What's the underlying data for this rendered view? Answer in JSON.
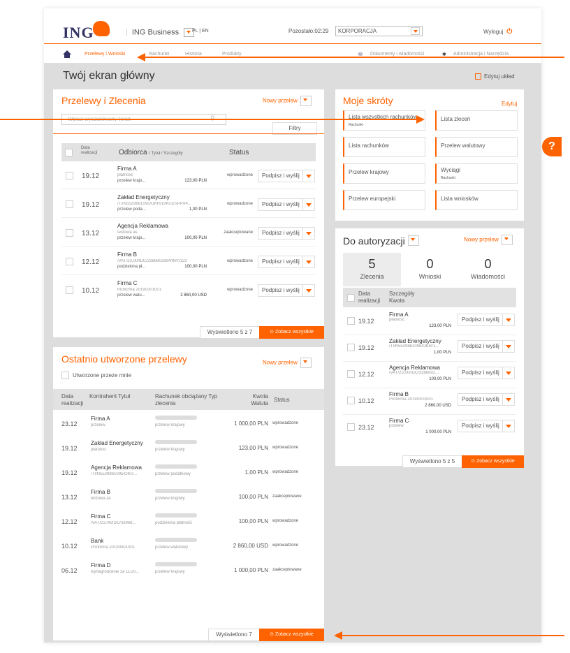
{
  "header": {
    "logo": "ING",
    "app_name": "ING Business",
    "lang": "PL | EN",
    "timer": "Pozostało:02:29",
    "company": "KORPORACJA",
    "logout": "Wyloguj"
  },
  "nav": {
    "items": [
      "Przelewy i Wnioski",
      "Rachunki",
      "Historia",
      "Produkty"
    ],
    "right": [
      "Dokumenty i wiadomości",
      "Administracja i Narzędzia"
    ]
  },
  "page": {
    "title": "Twój ekran główny",
    "edit_layout": "Edytuj układ",
    "help": "?"
  },
  "transfers": {
    "title": "Przelewy i Zlecenia",
    "new_label": "Nowy przelew",
    "search_placeholder": "Wpisz wyszukiwany tekst",
    "filters": "Filtry",
    "col_date": "Data realizacji",
    "col_recipient": "Odbiorca",
    "col_recipient_sub": "/ Tytuł / Szczegóły",
    "col_status": "Status",
    "sign_label": "Podpisz i wyślij",
    "rows": [
      {
        "date": "19.12",
        "name": "Firma A",
        "l1": "płatność",
        "l2": "przelew krajo...",
        "amount": "123,00 PLN",
        "status": "wprowadzone"
      },
      {
        "date": "19.12",
        "name": "Zakład Energetyczny",
        "l1": "/TI/N5529861095/OKR/19K01/SPP/Pł...",
        "l2": "przelew poda...",
        "amount": "1,00 PLN",
        "status": "wprowadzone"
      },
      {
        "date": "13.12",
        "name": "Agencja Reklamowa",
        "l1": "testowa as",
        "l2": "przelew krajo...",
        "amount": "100,00 PLN",
        "status": "zaakceptowane"
      },
      {
        "date": "12.12",
        "name": "Firma B",
        "l1": "/VAT/23,00/IDC/3386802894/INV/123",
        "l2": "podzielona pł...",
        "amount": "100,00 PLN",
        "status": "wprowadzone"
      },
      {
        "date": "10.12",
        "name": "Firma C",
        "l1": "Proforma 20190301001",
        "l2": "przelew walu...",
        "amount": "2 860,00 USD",
        "status": "wprowadzone"
      }
    ],
    "footer_count": "Wyświetlono 5 z 7",
    "footer_see_all": "Zobacz wszystkie"
  },
  "recent": {
    "title": "Ostatnio utworzone przelewy",
    "new_label": "Nowy przelew",
    "filter_mine": "Utworzone przeze mnie",
    "col_date": "Data realizacji",
    "col_contractor": "Kontrahent Tytuł",
    "col_account": "Rachunek obciążany Typ zlecenia",
    "col_amount": "Kwota Waluta",
    "col_status": "Status",
    "rows": [
      {
        "date": "23.12",
        "name": "Firma A",
        "title": "przelew",
        "type": "przelew krajowy",
        "amount": "1 000,00 PLN",
        "status": "wprowadzone"
      },
      {
        "date": "19.12",
        "name": "Zakład Energetyczny",
        "title": "płatność",
        "type": "przelew krajowy",
        "amount": "123,00 PLN",
        "status": "wprowadzone"
      },
      {
        "date": "19.12",
        "name": "Agencja Reklamowa",
        "title": "/TI/N5529861095/OKR...",
        "type": "przelew podatkowy",
        "amount": "1,00 PLN",
        "status": "wprowadzone"
      },
      {
        "date": "13.12",
        "name": "Firma B",
        "title": "testowa as",
        "type": "przelew krajowy",
        "amount": "100,00 PLN",
        "status": "zaakceptowane"
      },
      {
        "date": "12.12",
        "name": "Firma C",
        "title": "/VAT/23,00/IDC/33868...",
        "type": "podzielona płatność",
        "amount": "100,00 PLN",
        "status": "wprowadzone"
      },
      {
        "date": "10.12",
        "name": "Bank",
        "title": "Proforma 20190301001",
        "type": "przelew walutowy",
        "amount": "2 860,00 USD",
        "status": "wprowadzone"
      },
      {
        "date": "06.12",
        "name": "Firma D",
        "title": "wynagrodzenie za 11/20...",
        "type": "przelew krajowy",
        "amount": "1 000,00 PLN",
        "status": "zaakceptowane"
      }
    ],
    "footer_count": "Wyświetlono 7",
    "footer_see_all": "Zobacz wszystkie"
  },
  "shortcuts": {
    "title": "Moje skróty",
    "edit": "Edytuj",
    "tiles": [
      {
        "label": "Lista wszystkich rachunków",
        "sub": "Rachunki"
      },
      {
        "label": "Lista zleceń",
        "sub": ""
      },
      {
        "label": "Lista rachunków",
        "sub": ""
      },
      {
        "label": "Przelew walutowy",
        "sub": ""
      },
      {
        "label": "Przelew krajowy",
        "sub": ""
      },
      {
        "label": "Wyciągi",
        "sub": "Rachunki"
      },
      {
        "label": "Przelew europejski",
        "sub": ""
      },
      {
        "label": "Lista wniosków",
        "sub": ""
      }
    ]
  },
  "auth": {
    "title": "Do autoryzacji",
    "new_label": "Nowy przelew",
    "tabs": [
      {
        "count": "5",
        "label": "Zlecenia"
      },
      {
        "count": "0",
        "label": "Wnioski"
      },
      {
        "count": "0",
        "label": "Wiadomości"
      }
    ],
    "col_date": "Data realizacji",
    "col_details": "Szczegóły Kwota",
    "sign_label": "Podpisz i wyślij",
    "rows": [
      {
        "date": "19.12",
        "name": "Firma A",
        "l1": "płatność",
        "amount": "123,00 PLN"
      },
      {
        "date": "19.12",
        "name": "Zakład Energetyczny",
        "l1": "/TI/N5529861095/OKR/1...",
        "amount": "1,00 PLN"
      },
      {
        "date": "12.12",
        "name": "Agencja Reklamowa",
        "l1": "/VAT/23,00/IDC/3386802...",
        "amount": "100,00 PLN"
      },
      {
        "date": "10.12",
        "name": "Firma B",
        "l1": "Proforma 20190301001",
        "amount": "2 860,00 USD"
      },
      {
        "date": "23.12",
        "name": "Firma C",
        "l1": "przelew",
        "amount": "1 000,00 PLN"
      }
    ],
    "footer_count": "Wyświetlono 5 z 5",
    "footer_see_all": "Zobacz wszystkie"
  },
  "colors": {
    "accent": "#ff6200",
    "brand": "#333366",
    "background": "#dddddd"
  }
}
